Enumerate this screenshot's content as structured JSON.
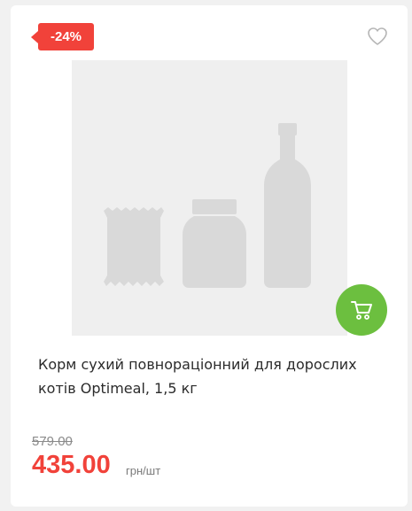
{
  "product": {
    "discount_badge": "-24%",
    "title": "Корм сухий повнораціонний для дорослих котів Optimeal, 1,5 кг",
    "old_price": "579.00",
    "price": "435.00",
    "unit": "грн/шт"
  },
  "icons": {
    "favorite": "heart-icon",
    "cart": "cart-icon",
    "placeholder": "product-placeholder-icon"
  },
  "colors": {
    "accent_red": "#f1423a",
    "cart_green": "#6cbf3f",
    "placeholder_bg": "#efefef",
    "placeholder_shape": "#d9d9d9"
  }
}
